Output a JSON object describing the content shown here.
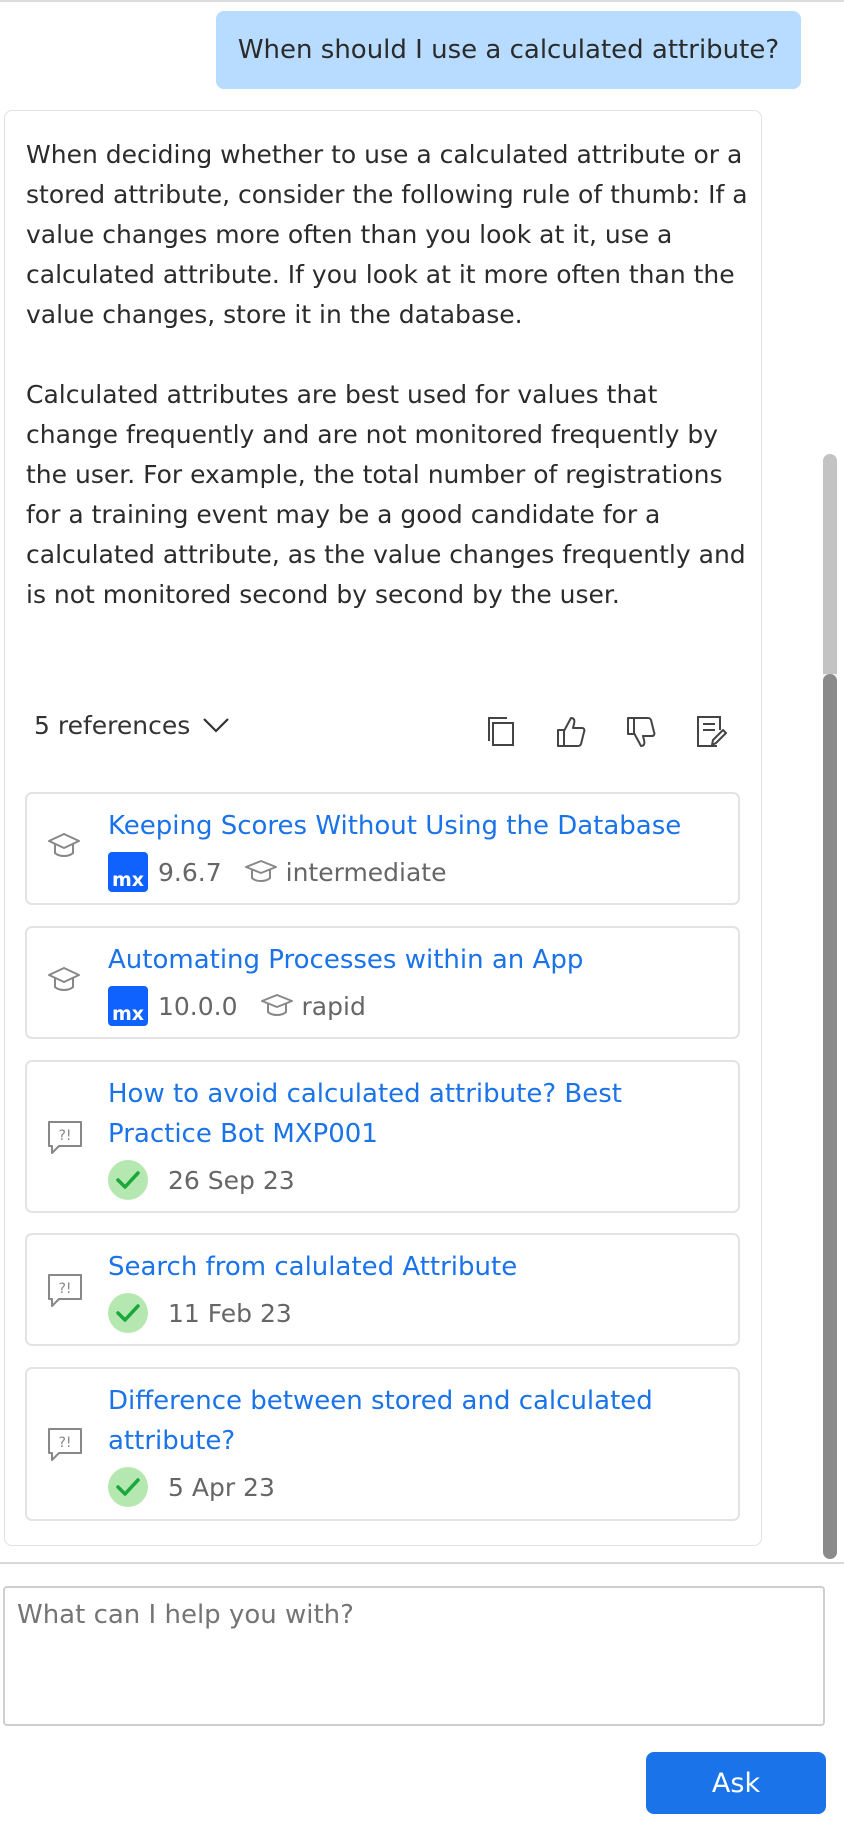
{
  "chat": {
    "user_message": "When should I use a calculated attribute?",
    "answer": {
      "paragraphs": [
        "When deciding whether to use a calculated attribute or a stored attribute, consider the following rule of thumb: If a value changes more often than you look at it, use a calculated attribute. If you look at it more often than the value changes, store it in the database.",
        "Calculated attributes are best used for values that change frequently and are not monitored frequently by the user. For example, the total number of registrations for a training event may be a good candidate for a calculated attribute, as the value changes frequently and is not monitored second by second by the user."
      ]
    }
  },
  "references": {
    "label": "5 references",
    "toggle_icon": "chevron-down-icon",
    "actions": [
      "copy-icon",
      "thumbs-up-icon",
      "thumbs-down-icon",
      "feedback-icon"
    ],
    "items": [
      {
        "type": "learning",
        "title": "Keeping Scores Without Using the Database",
        "version": "9.6.7",
        "level": "intermediate"
      },
      {
        "type": "learning",
        "title": "Automating Processes within an App",
        "version": "10.0.0",
        "level": "rapid"
      },
      {
        "type": "forum",
        "title": "How to avoid calculated attribute? Best Practice Bot MXP001",
        "date": "26 Sep 23"
      },
      {
        "type": "forum",
        "title": "Search from calulated Attribute",
        "date": "11 Feb 23"
      },
      {
        "type": "forum",
        "title": "Difference between stored and calculated attribute?",
        "date": "5 Apr 23"
      }
    ],
    "mx_badge": "mx"
  },
  "input": {
    "placeholder": "What can I help you with?",
    "value": ""
  },
  "ask_button": "Ask",
  "colors": {
    "user_bubble": "#b7dcff",
    "link": "#1a73e8",
    "ask_button": "#1a73e8",
    "mx_badge": "#0f62fe",
    "check_bg": "#b4e8b0",
    "check": "#1aa83c"
  }
}
